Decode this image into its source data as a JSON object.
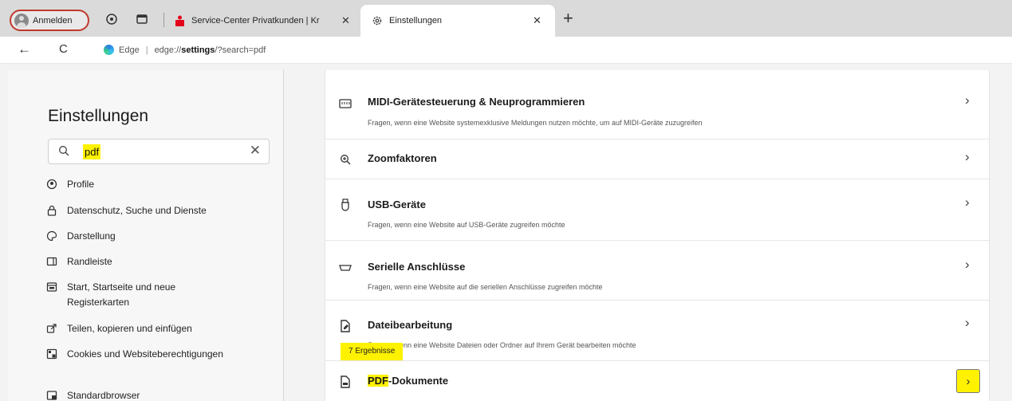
{
  "tabstrip": {
    "profile_label": "Anmelden",
    "tabs": [
      {
        "label": "Service-Center Privatkunden | Kr",
        "close": "✕",
        "favicon_color": "#e3001b"
      },
      {
        "label": "Einstellungen",
        "close": "✕"
      }
    ],
    "new_tab": "+"
  },
  "address_bar": {
    "back": "←",
    "refresh": "C",
    "site_name": "Edge",
    "url_prefix": "edge://",
    "url_bold": "settings",
    "url_suffix": "/?search=pdf"
  },
  "sidebar": {
    "title": "Einstellungen",
    "search_value": "pdf",
    "search_clear": "✕",
    "items": [
      {
        "label": "Profile",
        "icon": "profile-icon"
      },
      {
        "label": "Datenschutz, Suche und Dienste",
        "icon": "lock-icon"
      },
      {
        "label": "Darstellung",
        "icon": "appearance-icon"
      },
      {
        "label": "Randleiste",
        "icon": "sidebar-icon"
      },
      {
        "label": "Start, Startseite und neue Registerkarten",
        "icon": "home-icon"
      },
      {
        "label": "Teilen, kopieren und einfügen",
        "icon": "share-icon"
      },
      {
        "label": "Cookies und Websiteberechtigungen",
        "icon": "cookie-icon"
      },
      {
        "label": "Standardbrowser",
        "icon": "browser-icon"
      }
    ]
  },
  "settings_list": [
    {
      "title": "MIDI-Gerätesteuerung & Neuprogrammieren",
      "desc": "Fragen, wenn eine Website systemexklusive Meldungen nutzen möchte, um auf MIDI-Geräte zuzugreifen",
      "chevron": "›"
    },
    {
      "title": "Zoomfaktoren",
      "desc": "",
      "chevron": "›"
    },
    {
      "title": "USB-Geräte",
      "desc": "Fragen, wenn eine Website auf USB-Geräte zugreifen möchte",
      "chevron": "›"
    },
    {
      "title": "Serielle Anschlüsse",
      "desc": "Fragen, wenn eine Website auf die seriellen Anschlüsse zugreifen möchte",
      "chevron": "›"
    },
    {
      "title": "Dateibearbeitung",
      "desc": "Fragen, wenn eine Website Dateien oder Ordner auf Ihrem Gerät bearbeiten möchte",
      "chevron": "›"
    },
    {
      "title_highlight": "PDF",
      "title_rest": "-Dokumente",
      "chevron": "›"
    }
  ],
  "tooltip": "7 Ergebnisse",
  "colors": {
    "highlight": "#fff200",
    "profile_border": "#c0392b"
  }
}
